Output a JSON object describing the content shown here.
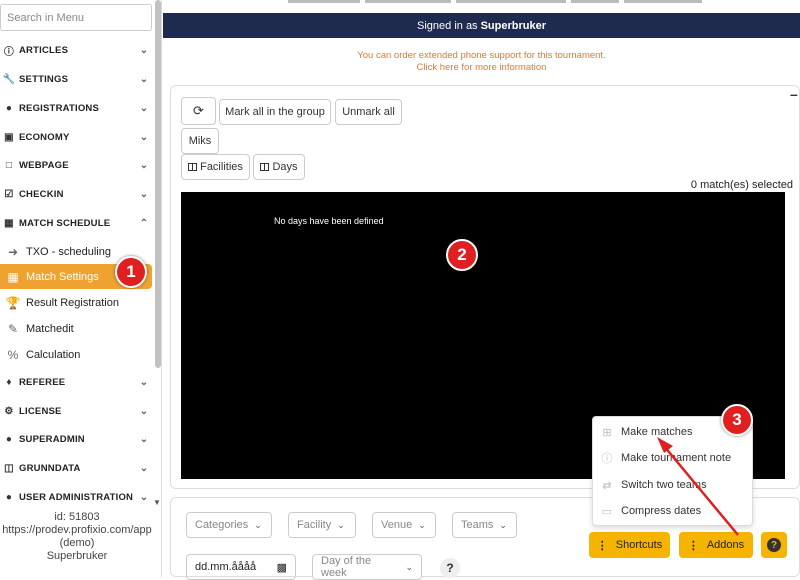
{
  "sidebar": {
    "search_placeholder": "Search in Menu",
    "items": [
      {
        "label": "ARTICLES",
        "icon": "info-icon"
      },
      {
        "label": "SETTINGS",
        "icon": "wrench-icon"
      },
      {
        "label": "REGISTRATIONS",
        "icon": "users-icon"
      },
      {
        "label": "ECONOMY",
        "icon": "money-icon"
      },
      {
        "label": "WEBPAGE",
        "icon": "page-icon"
      },
      {
        "label": "CHECKIN",
        "icon": "checkbox-icon"
      },
      {
        "label": "MATCH SCHEDULE",
        "icon": "grid-icon"
      }
    ],
    "sub_items": [
      {
        "label": "TXO - scheduling",
        "icon": "sign-in-icon"
      },
      {
        "label": "Match Settings",
        "icon": "table-icon"
      },
      {
        "label": "Result Registration",
        "icon": "trophy-icon"
      },
      {
        "label": "Matchedit",
        "icon": "edit-icon"
      },
      {
        "label": "Calculation",
        "icon": "percent-icon"
      }
    ],
    "items2": [
      {
        "label": "REFEREE",
        "icon": "bell-icon"
      },
      {
        "label": "LICENSE",
        "icon": "gear-icon"
      },
      {
        "label": "SUPERADMIN",
        "icon": "users-icon"
      },
      {
        "label": "GRUNNDATA",
        "icon": "database-icon"
      },
      {
        "label": "USER ADMINISTRATION",
        "icon": "users-icon"
      }
    ],
    "info": {
      "id": "id: 51803",
      "url": "https://prodev.profixio.com/app",
      "env": "(demo)",
      "user": "Superbruker"
    }
  },
  "banner": {
    "prefix": "Signed in as",
    "user": "Superbruker"
  },
  "support": {
    "line1": "You can order extended phone support for this tournament.",
    "line2": "Click here for more information"
  },
  "toolbar": {
    "refresh_icon": "refresh-icon",
    "mark_all": "Mark all in the group",
    "unmark_all": "Unmark all",
    "miks": "Miks",
    "facilities": "Facilities",
    "days": "Days"
  },
  "selection_status": "0 match(es) selected",
  "canvas_message": "No days have been defined",
  "markers": [
    "1",
    "2",
    "3"
  ],
  "addons_menu": [
    {
      "label": "Make matches",
      "icon": "grid-icon"
    },
    {
      "label": "Make tournament note",
      "icon": "info-circle-icon"
    },
    {
      "label": "Switch two teams",
      "icon": "swap-icon"
    },
    {
      "label": "Compress dates",
      "icon": "inbox-icon"
    }
  ],
  "filters": {
    "categories": "Categories",
    "facility": "Facility",
    "venue": "Venue",
    "teams": "Teams",
    "date_placeholder": "dd.mm.åååå",
    "day_of_week": "Day of the week",
    "help": "?"
  },
  "actions": {
    "shortcuts": "Shortcuts",
    "addons": "Addons",
    "help": "?"
  },
  "colors": {
    "accent": "#f0a230",
    "button_yellow": "#f5b400",
    "banner": "#1f2a4f",
    "marker": "#e02020",
    "support_text": "#e07b28"
  }
}
